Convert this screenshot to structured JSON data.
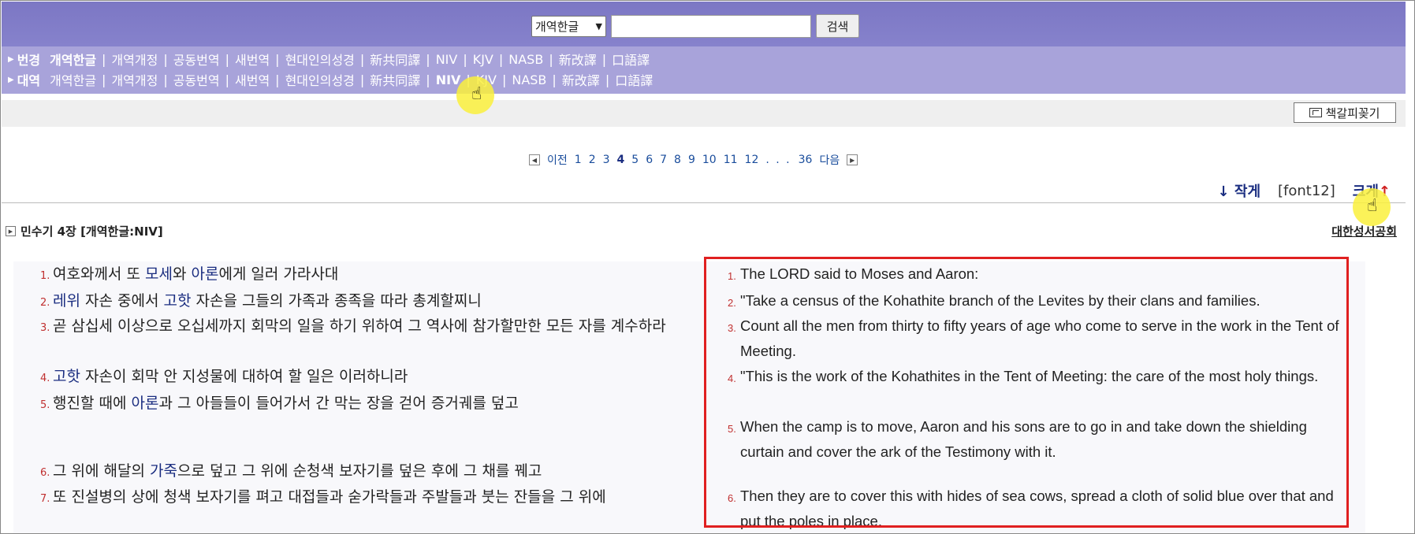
{
  "search": {
    "select_value": "개역한글",
    "input_value": "",
    "button_label": "검색"
  },
  "versions": {
    "row1": {
      "head": "번경",
      "items": [
        "개역한글",
        "개역개정",
        "공동번역",
        "새번역",
        "현대인의성경",
        "新共同譯",
        "NIV",
        "KJV",
        "NASB",
        "新改譯",
        "口語譯"
      ],
      "active": "개역한글"
    },
    "row2": {
      "head": "대역",
      "items": [
        "개역한글",
        "개역개정",
        "공동번역",
        "새번역",
        "현대인의성경",
        "新共同譯",
        "NIV",
        "KJV",
        "NASB",
        "新改譯",
        "口語譯"
      ],
      "active": "NIV"
    }
  },
  "bookmark_button": "책갈피꽂기",
  "pager": {
    "prev": "이전",
    "pages": [
      "1",
      "2",
      "3",
      "4",
      "5",
      "6",
      "7",
      "8",
      "9",
      "10",
      "11",
      "12"
    ],
    "current": "4",
    "ellipsis": ". . .",
    "last": "36",
    "next": "다음"
  },
  "font_control": {
    "smaller": "↓ 작게",
    "size": "[font12]",
    "bigger": "크게",
    "bigger_arrow": "↑"
  },
  "chapter_title": "민수기 4장 [개역한글:NIV]",
  "society_link": "대한성서공회",
  "korean_verses": [
    {
      "n": "1.",
      "parts": [
        [
          "여호와께서 또 ",
          false
        ],
        [
          "모세",
          true
        ],
        [
          "와 ",
          false
        ],
        [
          "아론",
          true
        ],
        [
          "에게 일러 가라사대",
          false
        ]
      ]
    },
    {
      "n": "2.",
      "parts": [
        [
          "레위",
          true
        ],
        [
          " 자손 중에서 ",
          false
        ],
        [
          "고핫",
          true
        ],
        [
          " 자손을 그들의 가족과 종족을 따라 총계할찌니",
          false
        ]
      ]
    },
    {
      "n": "3.",
      "parts": [
        [
          "곧 삼십세 이상으로 오십세까지 회막의 일을 하기 위하여 그 역사에 참가할만한 모든 자를 계수하라",
          false
        ]
      ]
    },
    {
      "n": "4.",
      "parts": [
        [
          "고핫",
          true
        ],
        [
          " 자손이 회막 안 지성물에 대하여 할 일은 이러하니라",
          false
        ]
      ]
    },
    {
      "n": "5.",
      "parts": [
        [
          "행진할 때에 ",
          false
        ],
        [
          "아론",
          true
        ],
        [
          "과 그 아들들이 들어가서 간 막는 장을 걷어 증거궤를 덮고",
          false
        ]
      ]
    },
    {
      "n": "6.",
      "parts": [
        [
          "그 위에 해달의 ",
          false
        ],
        [
          "가죽",
          true
        ],
        [
          "으로 덮고 그 위에 순청색 보자기를 덮은 후에 그 채를 꿰고",
          false
        ]
      ]
    },
    {
      "n": "7.",
      "parts": [
        [
          "또 진설병의 상에 청색 보자기를 펴고 대접들과 숟가락들과 주발들과 붓는 잔들을 그 위에",
          false
        ]
      ]
    }
  ],
  "english_verses": [
    {
      "n": "1.",
      "text": "The LORD said to Moses and Aaron:"
    },
    {
      "n": "2.",
      "text": "\"Take a census of the Kohathite branch of the Levites by their clans and families."
    },
    {
      "n": "3.",
      "text": "Count all the men from thirty to fifty years of age who come to serve in the work in the Tent of Meeting."
    },
    {
      "n": "4.",
      "text": "\"This is the work of the Kohathites in the Tent of Meeting: the care of the most holy things."
    },
    {
      "n": "5.",
      "text": "When the camp is to move, Aaron and his sons are to go in and take down the shielding curtain and cover the ark of the Testimony with it."
    },
    {
      "n": "6.",
      "text": "Then they are to cover this with hides of sea cows, spread a cloth of solid blue over that and put the poles in place."
    }
  ],
  "colors": {
    "top_band": "#7c77c4",
    "version_band": "#a8a3da",
    "link": "#1a4d9c",
    "highlight_box": "#e02020",
    "verse_number": "#c03030"
  }
}
